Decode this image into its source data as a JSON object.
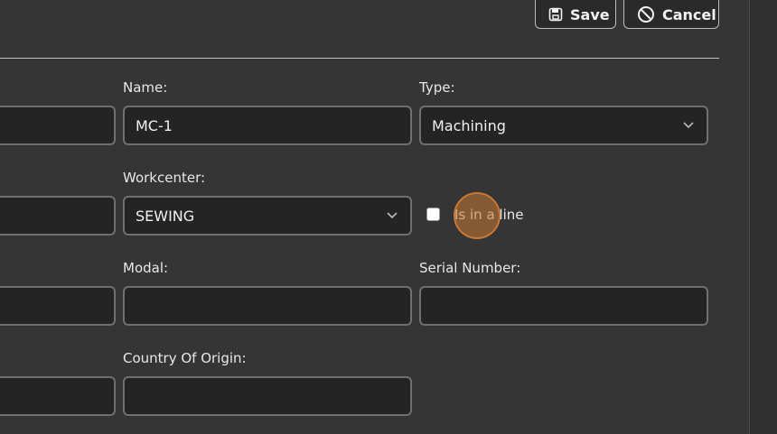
{
  "toolbar": {
    "save_label": "Save",
    "cancel_label": "Cancel"
  },
  "form": {
    "name": {
      "label": "Name:",
      "value": "MC-1"
    },
    "type": {
      "label": "Type:",
      "value": "Machining"
    },
    "workcenter": {
      "label": "Workcenter:",
      "value": "SEWING"
    },
    "is_in_line": {
      "label": "Is in a line",
      "checked": false
    },
    "modal": {
      "label": "Modal:",
      "value": ""
    },
    "serial_number": {
      "label": "Serial Number:",
      "value": ""
    },
    "country_of_origin": {
      "label": "Country Of Origin:",
      "value": ""
    }
  },
  "icons": {
    "save": "floppy-disk-icon",
    "cancel": "ban-icon",
    "dropdown": "chevron-down-icon"
  }
}
